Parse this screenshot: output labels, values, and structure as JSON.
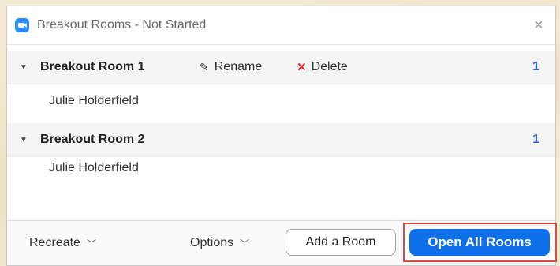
{
  "window": {
    "title": "Breakout Rooms - Not Started",
    "close_glyph": "×"
  },
  "rooms": [
    {
      "name": "Breakout Room 1",
      "count": "1",
      "participants": [
        "Julie Holderfield"
      ],
      "actions": {
        "rename": "Rename",
        "delete": "Delete"
      }
    },
    {
      "name": "Breakout Room 2",
      "count": "1",
      "participants": [
        "Julie Holderfield"
      ]
    }
  ],
  "footer": {
    "recreate_label": "Recreate",
    "options_label": "Options",
    "add_room_label": "Add a Room",
    "open_all_label": "Open All Rooms"
  },
  "icons": {
    "app": "zoom-camera-icon",
    "close": "close-icon",
    "caret": "caret-down-icon",
    "rename": "pencil-icon",
    "delete": "x-icon",
    "dropdown": "chevron-down-icon"
  },
  "colors": {
    "accent": "#0e71eb",
    "highlight_border": "#d64c44",
    "delete_red": "#e02828",
    "count_blue": "#2d6cdf"
  }
}
